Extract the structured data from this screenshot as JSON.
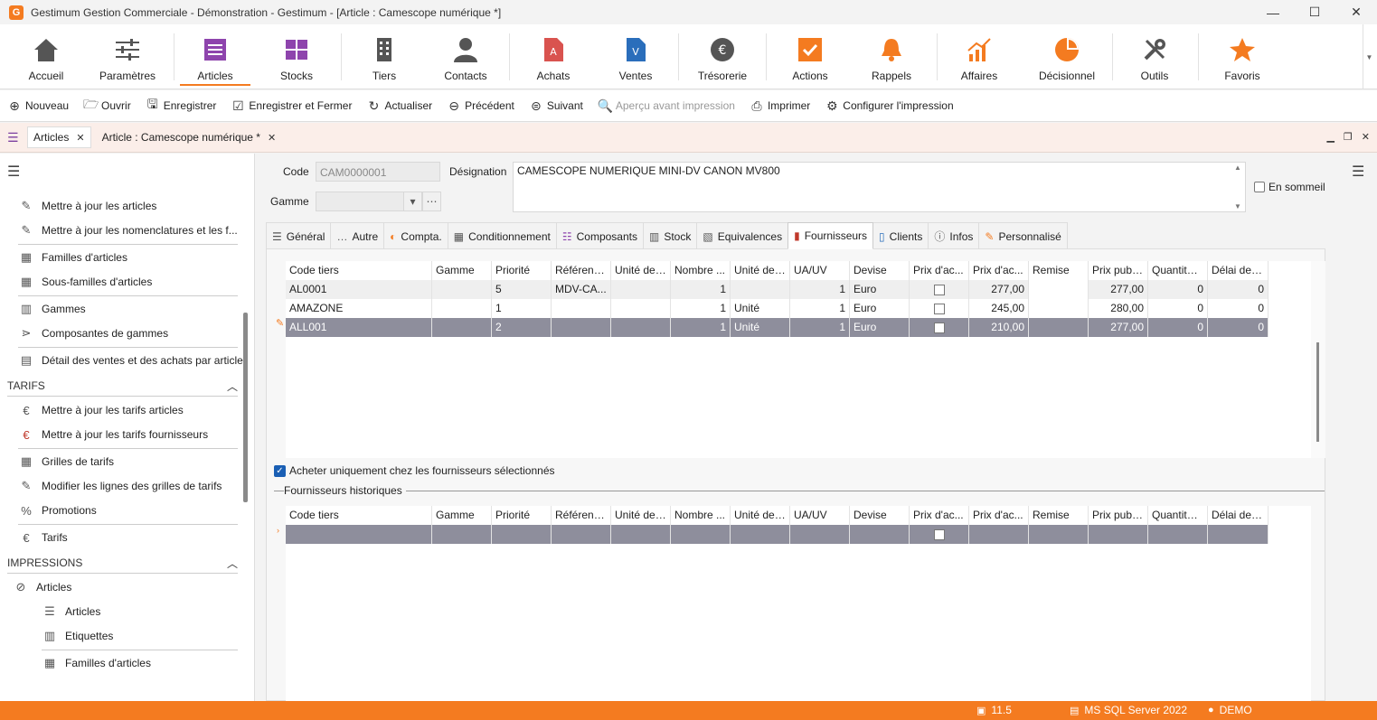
{
  "window": {
    "logo": "G",
    "title": "Gestimum Gestion Commerciale - Démonstration - Gestimum - [Article : Camescope numérique *]",
    "minimize": "—",
    "maximize": "☐",
    "close": "✕"
  },
  "ribbon": [
    {
      "label": "Accueil",
      "icon": "home-icon",
      "color": "#555555"
    },
    {
      "label": "Paramètres",
      "icon": "sliders-icon",
      "color": "#555555"
    },
    {
      "label": "Articles",
      "icon": "list-icon",
      "color": "#8e44ad"
    },
    {
      "label": "Stocks",
      "icon": "stock-icon",
      "color": "#8e44ad"
    },
    {
      "label": "Tiers",
      "icon": "building-icon",
      "color": "#555555"
    },
    {
      "label": "Contacts",
      "icon": "person-icon",
      "color": "#555555"
    },
    {
      "label": "Achats",
      "icon": "document-a-icon",
      "color": "#d9534f"
    },
    {
      "label": "Ventes",
      "icon": "document-v-icon",
      "color": "#2a6ebb"
    },
    {
      "label": "Trésorerie",
      "icon": "euro-icon",
      "color": "#555555"
    },
    {
      "label": "Actions",
      "icon": "check-icon",
      "color": "#f47b20"
    },
    {
      "label": "Rappels",
      "icon": "bell-icon",
      "color": "#f47b20"
    },
    {
      "label": "Affaires",
      "icon": "chart-up-icon",
      "color": "#f47b20"
    },
    {
      "label": "Décisionnel",
      "icon": "pie-icon",
      "color": "#f47b20"
    },
    {
      "label": "Outils",
      "icon": "tools-icon",
      "color": "#555555"
    },
    {
      "label": "Favoris",
      "icon": "star-icon",
      "color": "#f47b20"
    }
  ],
  "toolbar": {
    "nouveau": "Nouveau",
    "ouvrir": "Ouvrir",
    "enregistrer": "Enregistrer",
    "enregistrer_fermer": "Enregistrer et Fermer",
    "actualiser": "Actualiser",
    "precedent": "Précédent",
    "suivant": "Suivant",
    "apercu": "Aperçu avant impression",
    "imprimer": "Imprimer",
    "configurer": "Configurer l'impression"
  },
  "doctabs": {
    "articles": "Articles",
    "article_edit": "Article : Camescope numérique *"
  },
  "left_panel": {
    "items_top": [
      "Mettre à jour les articles",
      "Mettre à jour les nomenclatures et les f...",
      "Familles d'articles",
      "Sous-familles d'articles",
      "Gammes",
      "Composantes de gammes",
      "Détail des ventes et des achats par article"
    ],
    "group_tarifs": "TARIFS",
    "items_tarifs": [
      "Mettre à jour les tarifs articles",
      "Mettre à jour les tarifs fournisseurs",
      "Grilles de tarifs",
      "Modifier les lignes des grilles de tarifs",
      "Promotions",
      "Tarifs"
    ],
    "group_impressions": "IMPRESSIONS",
    "sub_articles": "Articles",
    "items_impressions": [
      "Articles",
      "Etiquettes",
      "Familles d'articles"
    ]
  },
  "form": {
    "code_label": "Code",
    "code_value": "CAM0000001",
    "gamme_label": "Gamme",
    "designation_label": "Désignation",
    "designation_value": "CAMESCOPE NUMERIQUE MINI-DV CANON MV800",
    "sommeil_label": "En sommeil"
  },
  "tabs": [
    {
      "label": "Général",
      "icon": "☰"
    },
    {
      "label": "Autre",
      "icon": "…"
    },
    {
      "label": "Compta.",
      "icon": "◐"
    },
    {
      "label": "Conditionnement",
      "icon": "▦"
    },
    {
      "label": "Composants",
      "icon": "☷"
    },
    {
      "label": "Stock",
      "icon": "▥"
    },
    {
      "label": "Equivalences",
      "icon": "▧"
    },
    {
      "label": "Fournisseurs",
      "icon": "▮"
    },
    {
      "label": "Clients",
      "icon": "▯"
    },
    {
      "label": "Infos",
      "icon": "ⓘ"
    },
    {
      "label": "Personnalisé",
      "icon": "✎"
    }
  ],
  "grid_columns": [
    "Code tiers",
    "Gamme",
    "Priorité",
    "Référenc...",
    "Unité de ...",
    "Nombre ...",
    "Unité de ...",
    "UA/UV",
    "Devise",
    "Prix d'ac...",
    "Prix d'ac...",
    "Remise",
    "Prix publi...",
    "Quantité ...",
    "Délai de l..."
  ],
  "fournisseurs": [
    {
      "code": "AL0001",
      "gamme": "",
      "priorite": "5",
      "reference": "MDV-CA...",
      "unite1": "",
      "nombre": "1",
      "unite2": "",
      "uauv": "1",
      "devise": "Euro",
      "prix_ac2": "277,00",
      "remise": "",
      "prix_public": "277,00",
      "quantite": "0",
      "delai": "0"
    },
    {
      "code": "AMAZONE",
      "gamme": "",
      "priorite": "1",
      "reference": "",
      "unite1": "",
      "nombre": "1",
      "unite2": "Unité",
      "uauv": "1",
      "devise": "Euro",
      "prix_ac2": "245,00",
      "remise": "",
      "prix_public": "280,00",
      "quantite": "0",
      "delai": "0"
    },
    {
      "code": "ALL001",
      "gamme": "",
      "priorite": "2",
      "reference": "",
      "unite1": "",
      "nombre": "1",
      "unite2": "Unité",
      "uauv": "1",
      "devise": "Euro",
      "prix_ac2": "210,00",
      "remise": "",
      "prix_public": "277,00",
      "quantite": "0",
      "delai": "0"
    }
  ],
  "acheter_label": "Acheter uniquement chez les fournisseurs sélectionnés",
  "historiques_label": "Fournisseurs historiques",
  "status": {
    "version": "11.5",
    "server": "MS SQL Server 2022",
    "user": "DEMO"
  }
}
